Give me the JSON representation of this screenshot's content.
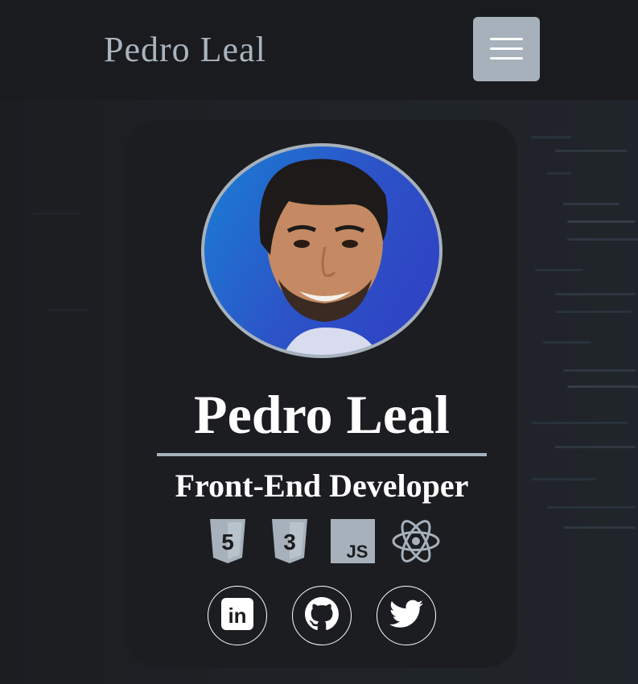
{
  "header": {
    "brand": "Pedro Leal",
    "menu_icon": "hamburger-menu-icon"
  },
  "profile": {
    "name": "Pedro Leal",
    "role": "Front-End Developer",
    "avatar": "profile-photo"
  },
  "tech_stack": [
    {
      "icon": "html5-icon",
      "label": "5"
    },
    {
      "icon": "css3-icon",
      "label": "3"
    },
    {
      "icon": "javascript-icon",
      "label": "JS"
    },
    {
      "icon": "react-icon"
    }
  ],
  "social_links": [
    {
      "icon": "linkedin-icon",
      "label": "in"
    },
    {
      "icon": "github-icon"
    },
    {
      "icon": "twitter-icon"
    }
  ],
  "colors": {
    "accent": "#a6b1bb",
    "card": "#1c1d20",
    "navbar": "#191b1e"
  }
}
